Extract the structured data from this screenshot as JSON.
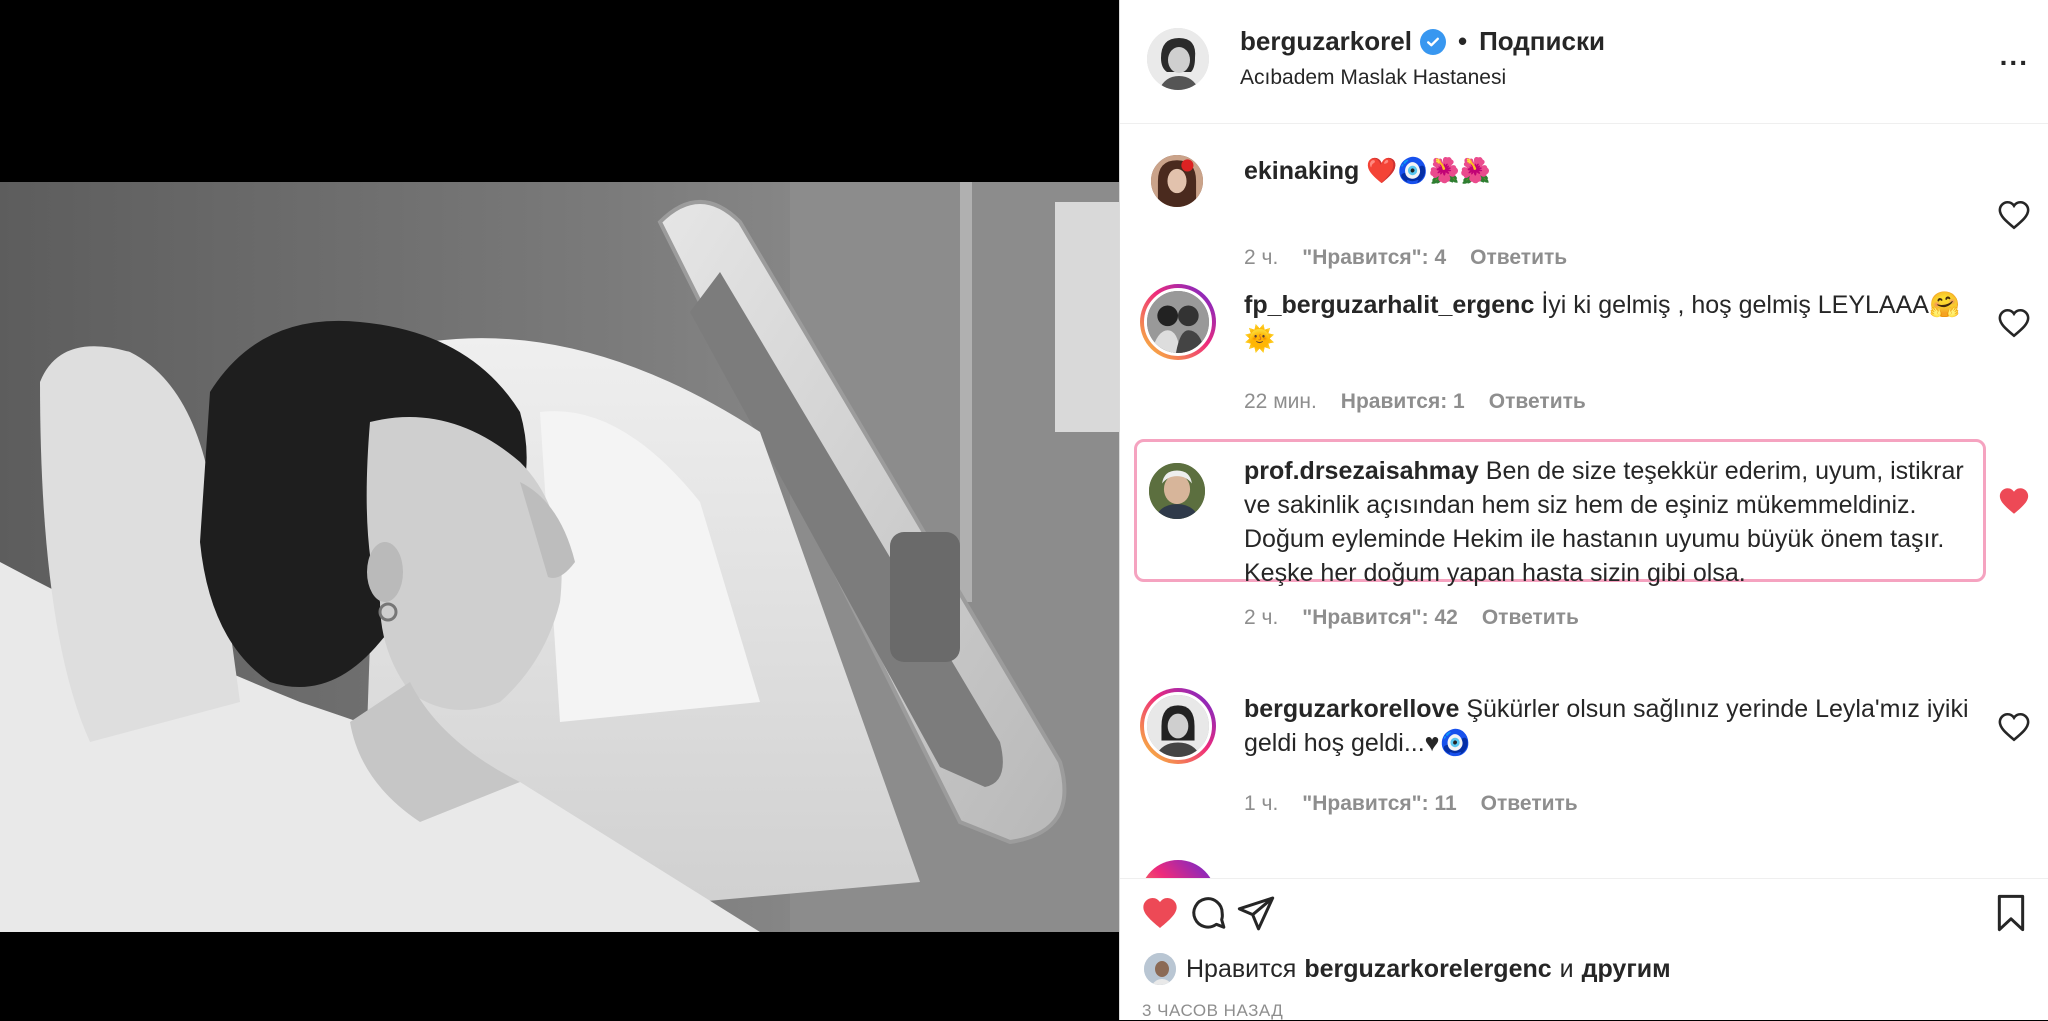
{
  "post": {
    "author": "berguzarkorel",
    "dot": "•",
    "follow_label": "Подписки",
    "location": "Acıbadem Maslak Hastanesi",
    "more_label": "...",
    "icons": {
      "verified": "verified-badge-icon",
      "more": "more-options-icon"
    }
  },
  "comments": [
    {
      "user": "ekinaking",
      "text": "❤️🧿🌺🌺",
      "time": "2 ч.",
      "likes": "\"Нравится\": 4",
      "reply": "Ответить",
      "liked": false
    },
    {
      "user": "fp_berguzarhalit_ergenc",
      "text": "İyi ki gelmiş , hoş gelmiş LEYLAAA🤗🌞",
      "time": "22 мин.",
      "likes": "Нравится: 1",
      "reply": "Ответить",
      "liked": false
    },
    {
      "user": "prof.drsezaisahmay",
      "text": "Ben de size teşekkür ederim, uyum, istikrar ve sakinlik açısından hem siz hem de eşiniz mükemmeldiniz. Doğum eyleminde Hekim ile hastanın uyumu büyük önem taşır. Keşke her doğum yapan hasta sizin gibi olsa.",
      "time": "2 ч.",
      "likes": "\"Нравится\": 42",
      "reply": "Ответить",
      "liked": true
    },
    {
      "user": "berguzarkorellove",
      "text": "Şükürler olsun sağlınız yerinde Leyla'mız iyiki geldi hoş geldi...♥🧿",
      "time": "1 ч.",
      "likes": "\"Нравится\": 11",
      "reply": "Ответить",
      "liked": false
    }
  ],
  "actions": {
    "icons": [
      "heart-filled-icon",
      "comment-icon",
      "share-icon",
      "bookmark-icon"
    ],
    "likes_prefix": "Нравится",
    "likes_user": "berguzarkorelergenc",
    "likes_and": "и",
    "likes_others": "другим",
    "time_ago": "3 ЧАСОВ НАЗАД"
  },
  "colors": {
    "like_red": "#ed4956",
    "highlight_pink": "#f5a3c0",
    "verified_blue": "#3897f0",
    "meta_gray": "#8e8e8e"
  }
}
